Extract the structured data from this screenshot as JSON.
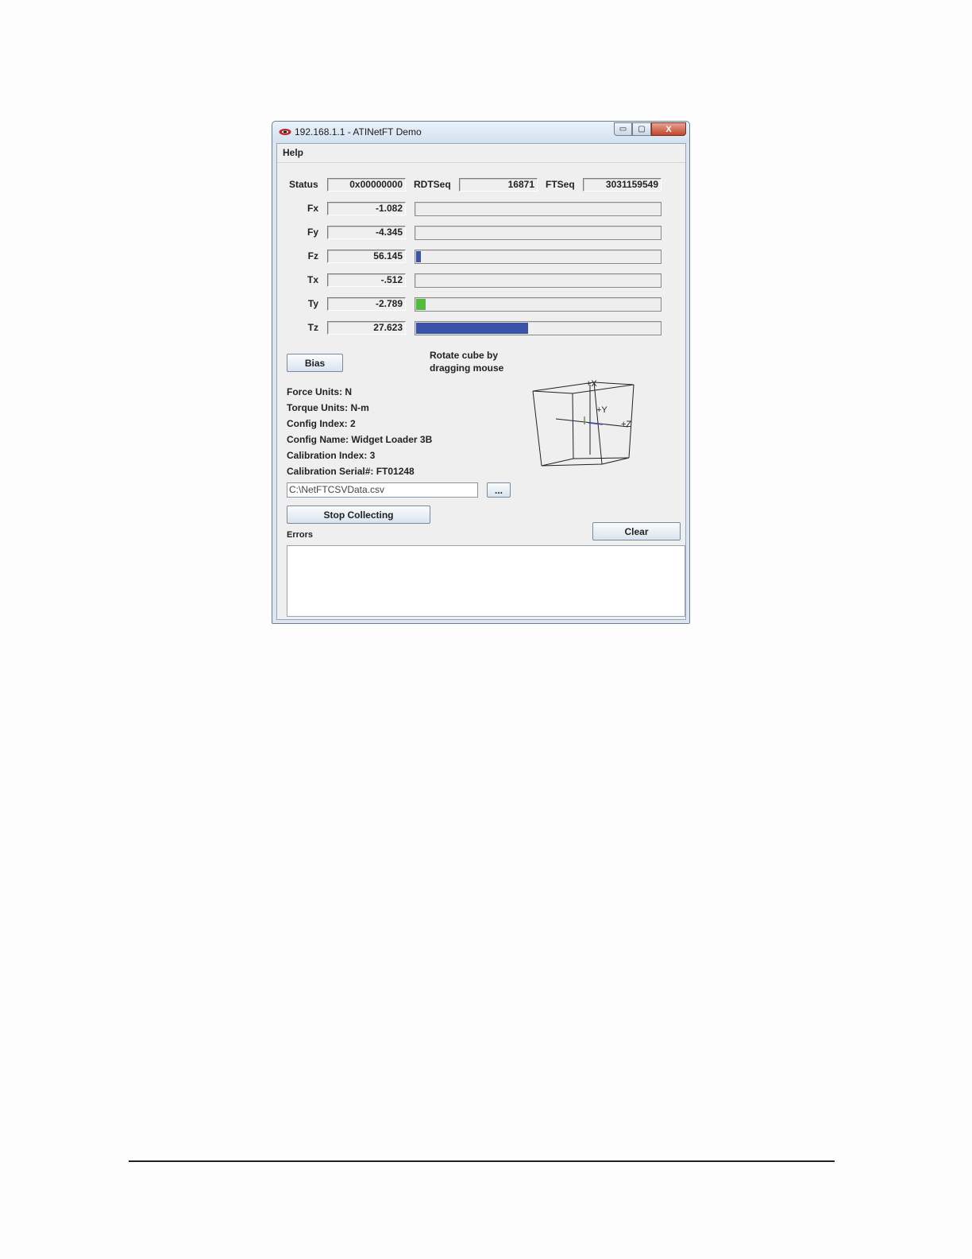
{
  "window": {
    "title": "192.168.1.1 - ATINetFT Demo",
    "controls": {
      "minimize": "▭",
      "maximize": "▢",
      "close": "X"
    }
  },
  "menu": {
    "help": "Help"
  },
  "status_row": {
    "status_label": "Status",
    "status_value": "0x00000000",
    "rdtseq_label": "RDTSeq",
    "rdtseq_value": "16871",
    "ftseq_label": "FTSeq",
    "ftseq_value": "3031159549"
  },
  "channels": [
    {
      "label": "Fx",
      "value": "-1.082",
      "bar_fraction": 0.0,
      "bar_color": "#3a52a8"
    },
    {
      "label": "Fy",
      "value": "-4.345",
      "bar_fraction": 0.0,
      "bar_color": "#3a52a8"
    },
    {
      "label": "Fz",
      "value": "56.145",
      "bar_fraction": 0.02,
      "bar_color": "#3a52a8"
    },
    {
      "label": "Tx",
      "value": "-.512",
      "bar_fraction": 0.0,
      "bar_color": "#3a52a8"
    },
    {
      "label": "Ty",
      "value": "-2.789",
      "bar_fraction": 0.04,
      "bar_color": "#55bb3c"
    },
    {
      "label": "Tz",
      "value": "27.623",
      "bar_fraction": 0.46,
      "bar_color": "#3a52a8"
    }
  ],
  "bias_button": "Bias",
  "rotate_hint": {
    "line1": "Rotate cube by",
    "line2": "dragging mouse"
  },
  "info": {
    "force_units": "Force Units: N",
    "torque_units": "Torque Units: N-m",
    "config_index": "Config Index: 2",
    "config_name": "Config Name: Widget Loader 3B",
    "calibration_index": "Calibration Index: 3",
    "calibration_serial": "Calibration Serial#: FT01248"
  },
  "csv_path": "C:\\NetFTCSVData.csv",
  "browse_button": "...",
  "collect_button": "Stop Collecting",
  "clear_button": "Clear",
  "errors_label": "Errors",
  "cube_axes": {
    "x": "+X",
    "y": "+Y",
    "z": "+Z"
  }
}
